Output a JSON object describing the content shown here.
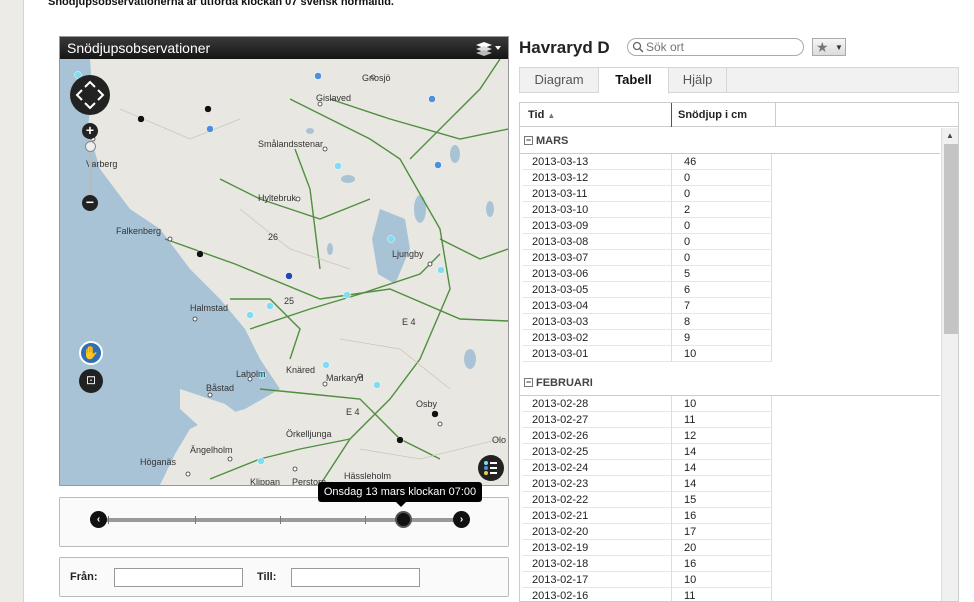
{
  "notice": "Snödjupsobservationerna är utförda klockan 07 svensk normaltid.",
  "map": {
    "title": "Snödjupsobservationer",
    "places": [
      "Gnosjö",
      "Gislaved",
      "Varberg",
      "Smålandsstenar",
      "Hyltebruk",
      "Falkenberg",
      "Ljungby",
      "Halmstad",
      "Laholm",
      "Knäred",
      "Markaryd",
      "Båstad",
      "Osby",
      "Örkelljunga",
      "Ängelholm",
      "Olo",
      "Höganäs",
      "Hässleholm",
      "Klippan",
      "Perstorp"
    ],
    "road_labels": [
      "26",
      "25",
      "E 4",
      "E 4"
    ],
    "colors": {
      "water": "#a9c3d6",
      "land": "#e9e7e1",
      "roads": "#4f8f3f"
    }
  },
  "timeline": {
    "tooltip": "Onsdag 13 mars klockan 07:00"
  },
  "range": {
    "from_label": "Från:",
    "to_label": "Till:",
    "from_value": "",
    "to_value": ""
  },
  "station": {
    "name": "Havraryd D",
    "search_placeholder": "Sök ort"
  },
  "tabs": [
    "Diagram",
    "Tabell",
    "Hjälp"
  ],
  "table": {
    "col_date": "Tid",
    "col_value": "Snödjup i cm",
    "groups": [
      {
        "name": "MARS",
        "rows": [
          [
            "2013-03-13",
            "46"
          ],
          [
            "2013-03-12",
            "0"
          ],
          [
            "2013-03-11",
            "0"
          ],
          [
            "2013-03-10",
            "2"
          ],
          [
            "2013-03-09",
            "0"
          ],
          [
            "2013-03-08",
            "0"
          ],
          [
            "2013-03-07",
            "0"
          ],
          [
            "2013-03-06",
            "5"
          ],
          [
            "2013-03-05",
            "6"
          ],
          [
            "2013-03-04",
            "7"
          ],
          [
            "2013-03-03",
            "8"
          ],
          [
            "2013-03-02",
            "9"
          ],
          [
            "2013-03-01",
            "10"
          ]
        ]
      },
      {
        "name": "FEBRUARI",
        "rows": [
          [
            "2013-02-28",
            "10"
          ],
          [
            "2013-02-27",
            "11"
          ],
          [
            "2013-02-26",
            "12"
          ],
          [
            "2013-02-25",
            "14"
          ],
          [
            "2013-02-24",
            "14"
          ],
          [
            "2013-02-23",
            "14"
          ],
          [
            "2013-02-22",
            "15"
          ],
          [
            "2013-02-21",
            "16"
          ],
          [
            "2013-02-20",
            "17"
          ],
          [
            "2013-02-19",
            "20"
          ],
          [
            "2013-02-18",
            "16"
          ],
          [
            "2013-02-17",
            "10"
          ],
          [
            "2013-02-16",
            "11"
          ]
        ]
      }
    ]
  }
}
